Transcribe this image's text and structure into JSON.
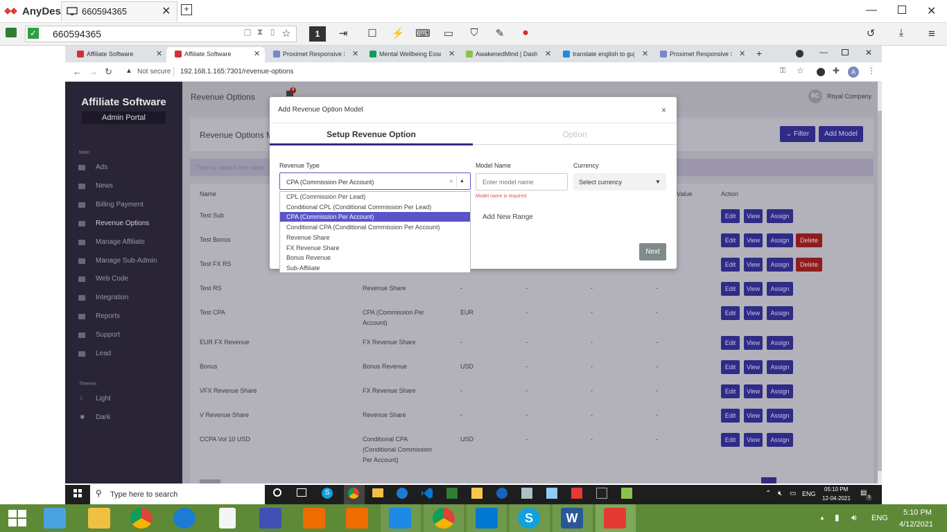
{
  "anydesk": {
    "app_name": "AnyDesk",
    "tab_id": "660594365",
    "address_value": "660594365",
    "toolbar_num": "1"
  },
  "browser": {
    "tabs": [
      {
        "label": "Affiliate Software"
      },
      {
        "label": "Affiliate Software"
      },
      {
        "label": "Proximet Responsive Sit"
      },
      {
        "label": "Mental Wellbeing Essen"
      },
      {
        "label": "AwakenedMind | Dashb"
      },
      {
        "label": "translate english to guja"
      },
      {
        "label": "Proximet Responsive Sit"
      }
    ],
    "new_tab": "+",
    "security": "Not secure",
    "url": "192.168.1.165:7301/revenue-options",
    "avatar_letter": "A"
  },
  "sidebar": {
    "title": "Affiliate Software",
    "subtitle": "Admin Portal",
    "section_main": "Main",
    "items": [
      "Ads",
      "News",
      "Billing Payment",
      "Revenue Options",
      "Manage Affiliate",
      "Manage Sub-Admin",
      "Web Code",
      "Integration",
      "Reports",
      "Support",
      "Lead"
    ],
    "section_themes": "Themes",
    "themes": [
      "Light",
      "Dark"
    ]
  },
  "header": {
    "title": "Revenue Options",
    "badge": "4",
    "user_initials": "RC",
    "user_name": "Royal Company"
  },
  "page": {
    "card_title": "Revenue Options M",
    "filter_btn": "Filter",
    "add_btn": "Add Model",
    "search_placeholder": "Type to search the name",
    "col_name": "Name",
    "col_value": "Value",
    "col_action": "Action",
    "rows": [
      {
        "name": "Test Sub",
        "type": "",
        "currency": "",
        "c4": "",
        "c5": "",
        "c6": "",
        "delete": false
      },
      {
        "name": "Test Bonus",
        "type": "",
        "currency": "",
        "c4": "",
        "c5": "",
        "c6": "",
        "delete": true
      },
      {
        "name": "Test FX RS",
        "type": "",
        "currency": "",
        "c4": "",
        "c5": "",
        "c6": "",
        "delete": true
      },
      {
        "name": "Test RS",
        "type": "Revenue Share",
        "currency": "-",
        "c4": "-",
        "c5": "-",
        "c6": "-",
        "delete": false
      },
      {
        "name": "Test CPA",
        "type": "CPA (Commission Per Account)",
        "currency": "EUR",
        "c4": "-",
        "c5": "-",
        "c6": "-",
        "delete": false
      },
      {
        "name": "EUR FX Revenue",
        "type": "FX Revenue Share",
        "currency": "-",
        "c4": "-",
        "c5": "-",
        "c6": "-",
        "delete": false
      },
      {
        "name": "Bonus",
        "type": "Bonus Revenue",
        "currency": "USD",
        "c4": "-",
        "c5": "-",
        "c6": "-",
        "delete": false
      },
      {
        "name": "VFX Revenue Share",
        "type": "FX Revenue Share",
        "currency": "-",
        "c4": "-",
        "c5": "-",
        "c6": "-",
        "delete": false
      },
      {
        "name": "V Revenue Share",
        "type": "Revenue Share",
        "currency": "-",
        "c4": "-",
        "c5": "-",
        "c6": "-",
        "delete": false
      },
      {
        "name": "CCPA Vol 10 USD",
        "type": "Conditional CPA (Conditional Commission Per Account)",
        "currency": "USD",
        "c4": "-",
        "c5": "-",
        "c6": "-",
        "delete": false
      }
    ],
    "edit": "Edit",
    "view": "View",
    "assign": "Assign",
    "delete": "Delete"
  },
  "modal": {
    "title": "Add Revenue Option Model",
    "close": "×",
    "tab1": "Setup Revenue Option",
    "tab2": "Option",
    "revenue_type_label": "Revenue Type",
    "revenue_type_value": "CPA (Commission Per Account)",
    "model_name_label": "Model Name",
    "model_name_placeholder": "Enter model name",
    "model_name_error": "Model name is required",
    "currency_label": "Currency",
    "currency_value": "Select currency",
    "add_range": "Add New Range",
    "next": "Next",
    "options": [
      "CPL (Commission Per Lead)",
      "Conditional CPL (Conditional Commission Per Lead)",
      "CPA (Commission Per Account)",
      "Conditional CPA (Conditional Commission Per Account)",
      "Revenue Share",
      "FX Revenue Share",
      "Bonus Revenue",
      "Sub-Affiliate"
    ],
    "selected_index": 2
  },
  "taskbar_inner": {
    "search_placeholder": "Type here to search",
    "lang": "ENG",
    "time": "05:10 PM",
    "date": "12-04-2021",
    "notif": "3"
  },
  "taskbar_host": {
    "lang": "ENG",
    "time": "5:10 PM",
    "date": "4/12/2021"
  },
  "colors": {
    "accent": "#2f2b86",
    "sidebar": "#292436",
    "anydesk_red": "#e53935"
  }
}
